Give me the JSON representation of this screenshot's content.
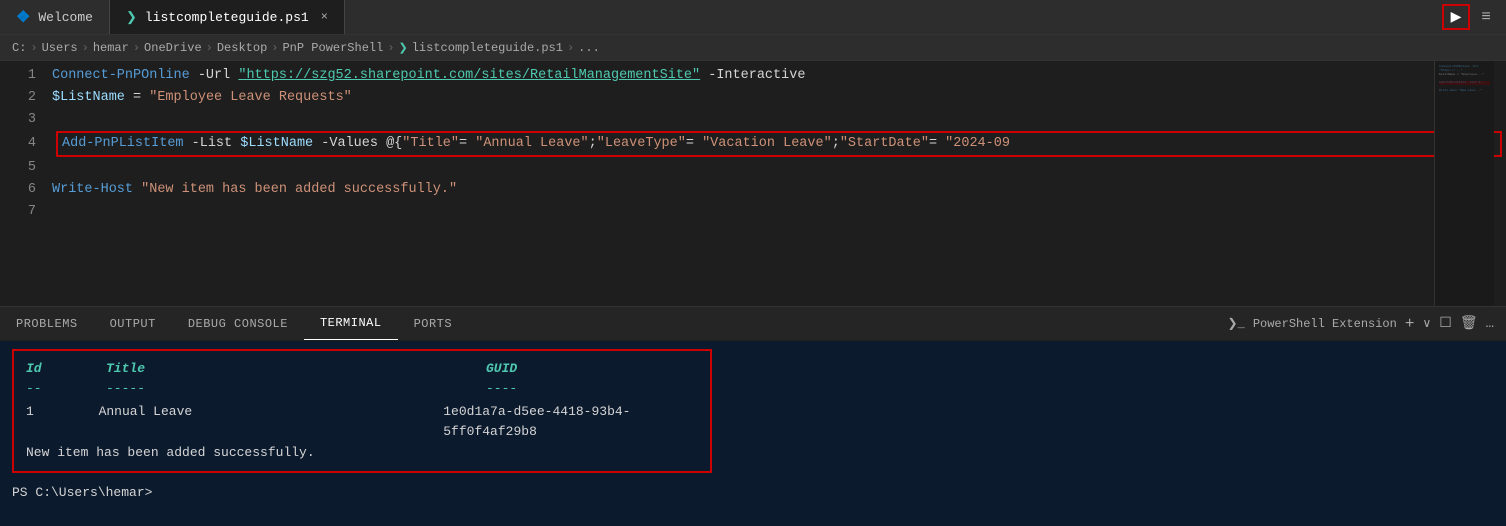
{
  "tabs": {
    "welcome": {
      "label": "Welcome",
      "icon": "vs-icon"
    },
    "active": {
      "label": "listcompleteguide.ps1",
      "icon": "ps-icon",
      "close": "×"
    }
  },
  "toolbar": {
    "run_label": "▶",
    "split_label": "⊟"
  },
  "breadcrumb": {
    "parts": [
      "C:",
      ">",
      "Users",
      ">",
      "hemar",
      ">",
      "OneDrive",
      ">",
      "Desktop",
      ">",
      "PnP PowerShell",
      ">",
      "listcompleteguide.ps1",
      ">",
      "..."
    ]
  },
  "code": {
    "lines": [
      {
        "num": "1",
        "parts": [
          {
            "text": "Connect-PnPOnline",
            "class": "kw-blue"
          },
          {
            "text": " -Url ",
            "class": "kw-white"
          },
          {
            "text": "\"https://szg52.sharepoint.com/sites/RetailManagementSite\"",
            "class": "kw-url"
          },
          {
            "text": " -Interactive",
            "class": "kw-white"
          }
        ]
      },
      {
        "num": "2",
        "parts": [
          {
            "text": "$ListName",
            "class": "kw-var"
          },
          {
            "text": " = ",
            "class": "kw-white"
          },
          {
            "text": "\"Employee Leave Requests\"",
            "class": "kw-string"
          }
        ]
      },
      {
        "num": "3",
        "parts": []
      },
      {
        "num": "4",
        "parts": [
          {
            "text": "Add-PnPListItem",
            "class": "kw-blue"
          },
          {
            "text": " -List ",
            "class": "kw-white"
          },
          {
            "text": "$ListName",
            "class": "kw-var"
          },
          {
            "text": " -Values @{",
            "class": "kw-white"
          },
          {
            "text": "\"Title\"",
            "class": "kw-string"
          },
          {
            "text": "= ",
            "class": "kw-white"
          },
          {
            "text": "\"Annual Leave\"",
            "class": "kw-string"
          },
          {
            "text": ";",
            "class": "kw-white"
          },
          {
            "text": "\"LeaveType\"",
            "class": "kw-string"
          },
          {
            "text": "= ",
            "class": "kw-white"
          },
          {
            "text": "\"Vacation Leave\"",
            "class": "kw-string"
          },
          {
            "text": ";",
            "class": "kw-white"
          },
          {
            "text": "\"StartDate\"",
            "class": "kw-string"
          },
          {
            "text": "= ",
            "class": "kw-white"
          },
          {
            "text": "\"2024-09",
            "class": "kw-string"
          }
        ],
        "highlight": true
      },
      {
        "num": "5",
        "parts": []
      },
      {
        "num": "6",
        "parts": [
          {
            "text": "Write-Host",
            "class": "kw-blue"
          },
          {
            "text": " ",
            "class": "kw-white"
          },
          {
            "text": "\"New item has been added successfully.\"",
            "class": "kw-string"
          }
        ]
      },
      {
        "num": "7",
        "parts": []
      }
    ]
  },
  "panel_tabs": {
    "items": [
      "PROBLEMS",
      "OUTPUT",
      "DEBUG CONSOLE",
      "TERMINAL",
      "PORTS"
    ],
    "active": "TERMINAL"
  },
  "panel_right": {
    "icon": "▶",
    "label": "PowerShell Extension",
    "add": "+",
    "chevron": "∨",
    "split": "⧉",
    "trash": "🗑",
    "more": "…"
  },
  "terminal": {
    "output": {
      "headers": {
        "id": "Id",
        "title": "Title",
        "guid": "GUID"
      },
      "separators": {
        "id": "--",
        "title": "-----",
        "guid": "----"
      },
      "data": {
        "id": "1",
        "title": "Annual Leave",
        "guid": "1e0d1a7a-d5ee-4418-93b4-5ff0f4af29b8"
      },
      "success_message": "New item has been added successfully."
    },
    "prompt": "PS C:\\Users\\hemar>"
  }
}
